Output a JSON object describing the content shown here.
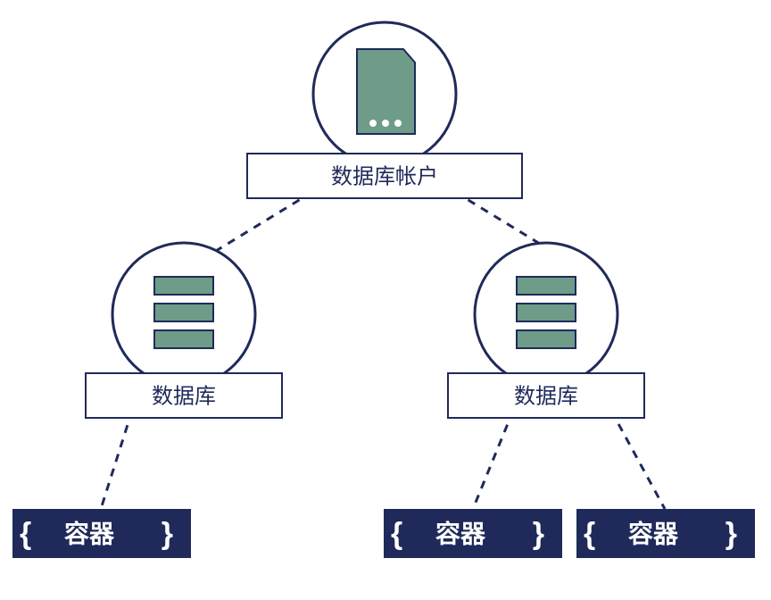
{
  "diagram": {
    "root": {
      "label": "数据库帐户",
      "icon": "file-icon"
    },
    "databases": [
      {
        "label": "数据库",
        "icon": "database-icon"
      },
      {
        "label": "数据库",
        "icon": "database-icon"
      }
    ],
    "containers": [
      {
        "label": "容器",
        "brace_open": "{",
        "brace_close": "}"
      },
      {
        "label": "容器",
        "brace_open": "{",
        "brace_close": "}"
      },
      {
        "label": "容器",
        "brace_open": "{",
        "brace_close": "}"
      }
    ]
  },
  "colors": {
    "accent": "#1f2a5a",
    "shape_fill": "#6e9c88",
    "container_bg": "#1f2a5a"
  }
}
